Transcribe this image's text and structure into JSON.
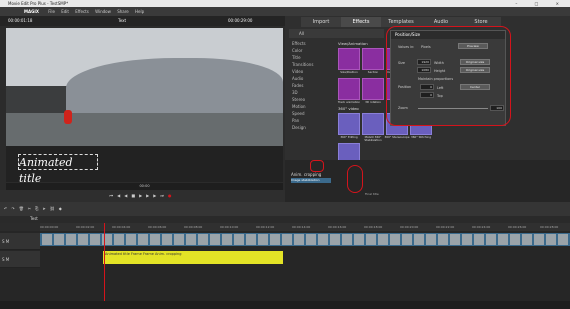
{
  "window": {
    "title": "Movie Edit Pro Plus - TestSMP*",
    "controls": "– □ ×"
  },
  "menu": {
    "brand": "MAGIX",
    "items": [
      "File",
      "Edit",
      "Effects",
      "Window",
      "Share",
      "Help"
    ]
  },
  "preview": {
    "timecode_left": "00:00:01:18",
    "mode": "Text",
    "timecode_right": "00:00:29:00",
    "animated_title": "Animated title",
    "scrub_time": "00:00"
  },
  "tabs": [
    {
      "label": "Import"
    },
    {
      "label": "Effects",
      "active": true
    },
    {
      "label": "Templates"
    },
    {
      "label": "Audio"
    },
    {
      "label": "Store"
    }
  ],
  "effects": {
    "filter": "All",
    "categories": [
      "Effects",
      "Color",
      "Title",
      "Transitions",
      "Video",
      "Audio",
      "Fades",
      "3D",
      "Stereo",
      "Motion",
      "Speed",
      "Pan",
      "Design"
    ],
    "section_motion": "View/Animation",
    "section_360": "360° video",
    "tiles_row1": [
      "Size/Position",
      "Section",
      "Camera/zoom shot",
      "Rotation/Mirror"
    ],
    "tiles_row2": [
      "Track animation",
      "3D rotation",
      "Shot"
    ],
    "tiles_row3": [
      "360° Editing",
      "MAGIX 360° Stabilization",
      "360° Stereoscope",
      "360° Stitching"
    ],
    "tiles_row4": [
      "360° Stabilizing"
    ]
  },
  "possize": {
    "title": "Position/Size",
    "values_label": "Values in:",
    "unit": "Pixels",
    "preview_btn": "Preview",
    "size_label": "Size",
    "width": "1920",
    "width_lbl": "Width",
    "height": "1080",
    "height_lbl": "Height",
    "btn_orig": "Original size",
    "btn_orig2": "Original size",
    "keep": "Maintain proportions",
    "position_label": "Position",
    "x": "0",
    "x_lbl": "Left",
    "y": "0",
    "y_lbl": "Top",
    "center_btn": "Center",
    "zoom_label": "Zoom",
    "zoom_val": "100"
  },
  "mid": {
    "label": "Anim. cropping",
    "clip": "Image stabilization",
    "title_clip": "Final title"
  },
  "timeline": {
    "tab": "Test",
    "ruler_time": "00:00:29:00",
    "titleclip": "Animated title  Frame  Frame  Anim. cropping",
    "track1": "S M",
    "track2": "S M"
  },
  "ruler": [
    "00:00:00:00",
    "00:00:02:00",
    "00:00:04:00",
    "00:00:06:00",
    "00:00:08:00",
    "00:00:10:00",
    "00:00:12:00",
    "00:00:14:00",
    "00:00:16:00",
    "00:00:18:00",
    "00:00:20:00",
    "00:00:22:00",
    "00:00:24:00",
    "00:00:26:00",
    "00:00:28:00"
  ]
}
